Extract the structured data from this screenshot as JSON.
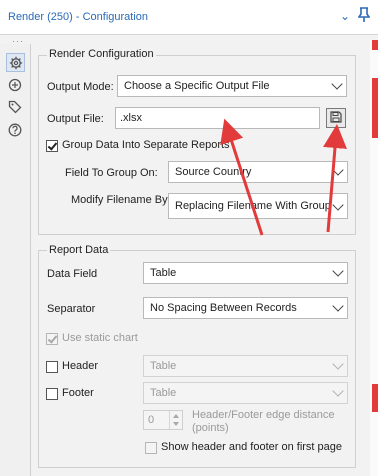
{
  "window": {
    "title": "Render (250) - Configuration",
    "collapse_icon": "chevron-down-icon",
    "pin_icon": "pin-icon",
    "overflow_dots": "···"
  },
  "sidebar": {
    "icons": [
      "gear-icon",
      "annotation-icon",
      "tag-icon",
      "help-icon"
    ]
  },
  "render_config": {
    "title": "Render Configuration",
    "output_mode_label": "Output Mode:",
    "output_mode_value": "Choose a Specific Output File",
    "output_file_label": "Output File:",
    "output_file_value": ".xlsx",
    "save_icon": "save-icon",
    "group_checkbox_label": "Group Data Into Separate Reports",
    "group_checked": true,
    "field_to_group_label": "Field To Group On:",
    "field_to_group_value": "Source Country",
    "modify_filename_label": "Modify Filename By:",
    "modify_filename_value": "Replacing Filename With Group"
  },
  "report_data": {
    "title": "Report Data",
    "data_field_label": "Data Field",
    "data_field_value": "Table",
    "separator_label": "Separator",
    "separator_value": "No Spacing Between Records",
    "static_chart_label": "Use static chart",
    "static_chart_checked": true,
    "header_label": "Header",
    "header_value": "Table",
    "header_checked": false,
    "footer_label": "Footer",
    "footer_value": "Table",
    "footer_checked": false,
    "distance_value": "0",
    "distance_label_line1": "Header/Footer edge distance",
    "distance_label_line2": "(points)",
    "show_first_page_label": "Show header and footer on first page",
    "show_first_page_checked": false
  },
  "colors": {
    "title_blue": "#2a6ab8",
    "arrow_red": "#e23b3b"
  }
}
